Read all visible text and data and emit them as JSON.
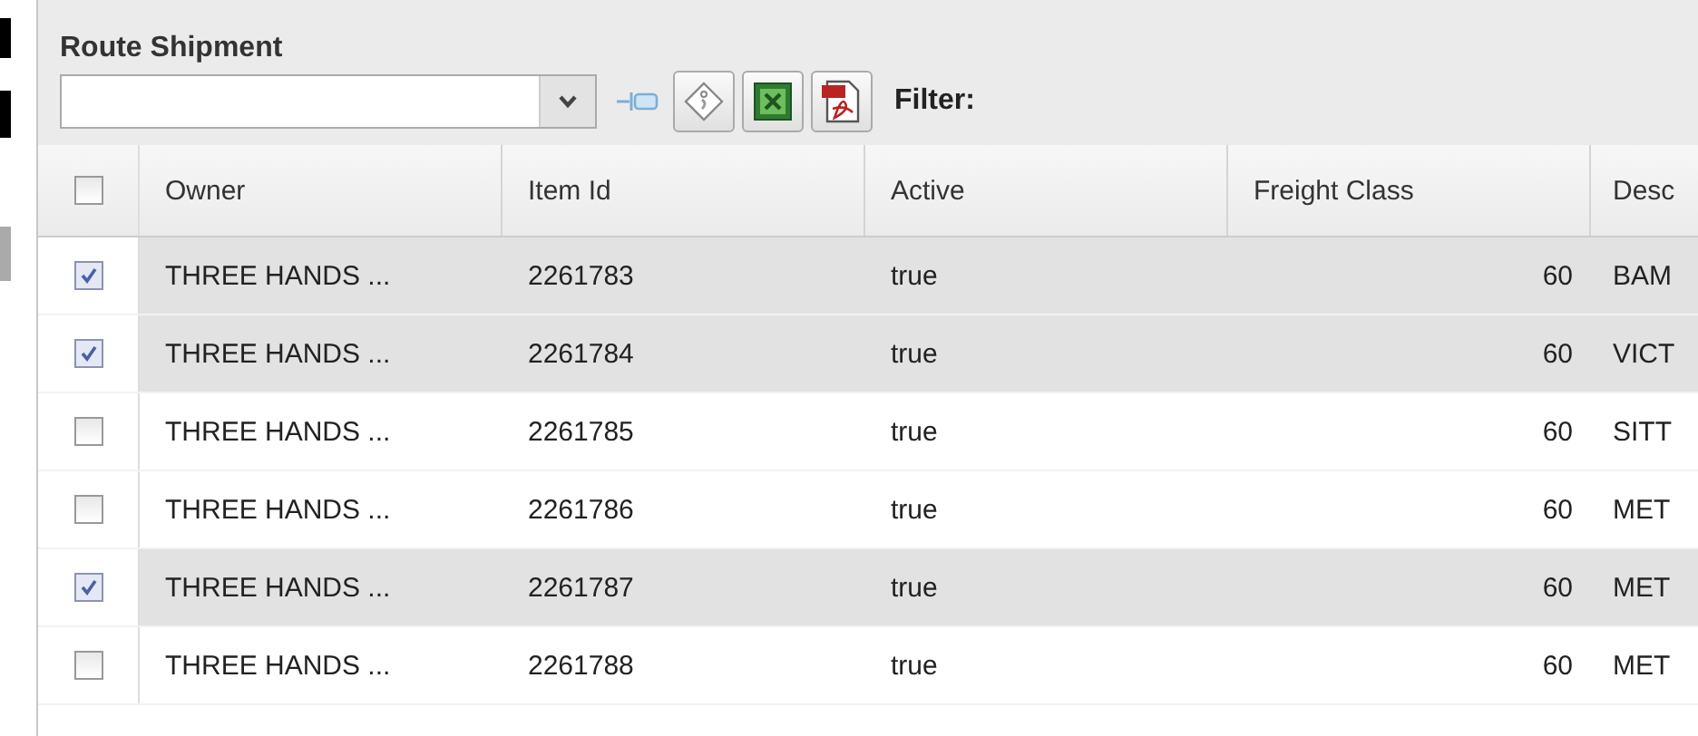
{
  "panel": {
    "title": "Route Shipment"
  },
  "toolbar": {
    "filter_label": "Filter:"
  },
  "table": {
    "all_checked": false,
    "columns": [
      "Owner",
      "Item Id",
      "Active",
      "Freight Class",
      "Desc"
    ],
    "rows": [
      {
        "checked": true,
        "cells": [
          "THREE HANDS ...",
          "2261783",
          "true",
          "60",
          "BAM"
        ]
      },
      {
        "checked": true,
        "cells": [
          "THREE HANDS ...",
          "2261784",
          "true",
          "60",
          "VICT"
        ]
      },
      {
        "checked": false,
        "cells": [
          "THREE HANDS ...",
          "2261785",
          "true",
          "60",
          "SITT"
        ]
      },
      {
        "checked": false,
        "cells": [
          "THREE HANDS ...",
          "2261786",
          "true",
          "60",
          "MET"
        ]
      },
      {
        "checked": true,
        "cells": [
          "THREE HANDS ...",
          "2261787",
          "true",
          "60",
          "MET"
        ]
      },
      {
        "checked": false,
        "cells": [
          "THREE HANDS ...",
          "2261788",
          "true",
          "60",
          "MET"
        ]
      }
    ]
  }
}
